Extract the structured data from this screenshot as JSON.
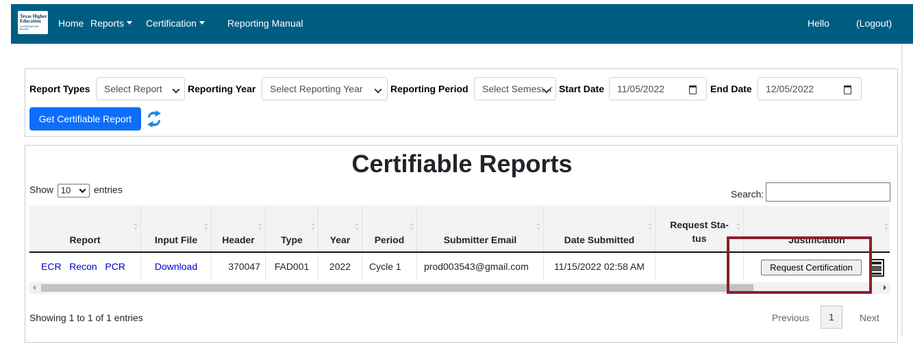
{
  "nav": {
    "logo_line1": "Texas Higher Education",
    "logo_line2": "COORDINATING BOARD",
    "home": "Home",
    "reports": "Reports",
    "certification": "Certification",
    "manual": "Reporting Manual",
    "hello": "Hello",
    "logout": "(Logout)"
  },
  "filters": {
    "report_types_label": "Report Types",
    "report_types_value": "Select Report",
    "year_label": "Reporting Year",
    "year_value": "Select Reporting Year",
    "period_label": "Reporting Period",
    "period_value": "Select Semester",
    "start_label": "Start Date",
    "start_value": "11/05/2022",
    "end_label": "End Date",
    "end_value": "12/05/2022",
    "get_button": "Get Certifiable Report"
  },
  "reports": {
    "title": "Certifiable Reports",
    "show_label": "Show",
    "entries_value": "10",
    "entries_label": "entries",
    "search_label": "Search:",
    "columns": [
      "Report",
      "Input File",
      "Header",
      "Type",
      "Year",
      "Period",
      "Submitter Email",
      "Date Submitted",
      "Request Sta-\ntus",
      "Justification"
    ],
    "row": {
      "report_links": [
        "ECR",
        "Recon",
        "PCR"
      ],
      "input_file": "Download",
      "header": "370047",
      "type": "FAD001",
      "year": "2022",
      "period": "Cycle 1",
      "email": "prod003543@gmail.com",
      "date": "11/15/2022 02:58 AM",
      "status": "",
      "action": "Request Certification"
    },
    "info": "Showing 1 to 1 of 1 entries",
    "previous": "Previous",
    "page": "1",
    "next": "Next"
  },
  "colors": {
    "navbar": "#005d82",
    "primary": "#0d6efd",
    "highlight": "#8b1e2d"
  }
}
